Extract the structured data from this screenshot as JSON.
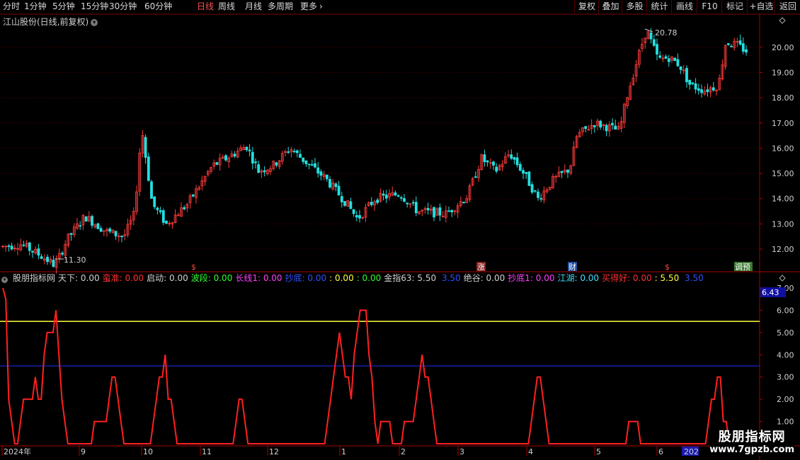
{
  "toolbar": {
    "periods": [
      "分时",
      "1分钟",
      "5分钟",
      "15分钟",
      "30分钟",
      "60分钟",
      "日线",
      "周线",
      "月线",
      "多周期",
      "更多"
    ],
    "active_period": "日线",
    "more_arrow": "›",
    "right_buttons": [
      "复权",
      "叠加",
      "多股",
      "统计",
      "画线",
      "F10",
      "标记",
      "+自选",
      "返回"
    ]
  },
  "main_chart": {
    "title": "江山股份(日线,前复权)",
    "high_label": "20.78",
    "low_label": "11.30",
    "y_ticks": [
      "20.00",
      "19.00",
      "18.00",
      "17.00",
      "16.00",
      "15.00",
      "14.00",
      "13.00",
      "12.00"
    ],
    "event_markers": [
      "$",
      "涨",
      "财",
      "$",
      "调预"
    ],
    "colors": {
      "up": "#ff3b3b",
      "down": "#22e0e0",
      "grid": "#5a0000",
      "axis": "#aa0000"
    }
  },
  "indicator": {
    "name": "股朋指标网",
    "items": [
      {
        "label": "天下:",
        "value": "0.00",
        "color": "#d0d0d0"
      },
      {
        "label": "蛮准:",
        "value": "0.00",
        "color": "#ff3030"
      },
      {
        "label": "启动:",
        "value": "0.00",
        "color": "#d0d0d0"
      },
      {
        "label": "波段:",
        "value": "0.00",
        "color": "#30ff30"
      },
      {
        "label": "长线1:",
        "value": "0.00",
        "color": "#ff40ff"
      },
      {
        "label": "抄底:",
        "value": "0.00",
        "color": "#3050ff"
      },
      {
        "label": ":",
        "value": "0.00",
        "color": "#ffff40"
      },
      {
        "label": ":",
        "value": "0.00",
        "color": "#30ff30"
      },
      {
        "label": "金指63:",
        "value": "5.50",
        "color": "#d0d0d0"
      },
      {
        "label": "",
        "value": "3.50",
        "color": "#3050ff"
      },
      {
        "label": "绝谷:",
        "value": "0.00",
        "color": "#d0d0d0"
      },
      {
        "label": "抄底1:",
        "value": "0.00",
        "color": "#ff40ff"
      },
      {
        "label": "江湖:",
        "value": "0.00",
        "color": "#40e0ff"
      },
      {
        "label": "买得好:",
        "value": "0.00",
        "color": "#ff3030"
      },
      {
        "label": ":",
        "value": "5.50",
        "color": "#ffff40"
      },
      {
        "label": "",
        "value": "3.50",
        "color": "#3050ff"
      }
    ],
    "y_ticks": [
      "7.00",
      "6.00",
      "5.00",
      "4.00",
      "3.00",
      "2.00",
      "1.00"
    ],
    "current_value": "6.43",
    "yellow_level": 5.5,
    "blue_level": 3.5,
    "line_color": "#ff2020",
    "line_values": [
      7,
      6.5,
      2,
      1,
      0,
      0,
      1,
      2,
      2,
      2,
      2,
      3,
      2,
      2,
      4,
      5,
      5,
      5,
      6,
      4,
      2,
      1,
      0,
      0,
      0,
      0,
      0,
      0,
      0,
      0,
      0,
      1,
      1,
      1,
      1,
      1,
      2,
      3,
      3,
      2,
      1,
      0,
      0,
      0,
      0,
      0,
      0,
      0,
      0,
      0,
      0,
      1,
      2,
      3,
      3,
      4,
      2,
      2,
      1,
      0,
      0,
      0,
      0,
      0,
      0,
      0,
      0,
      0,
      0,
      0,
      0,
      0,
      0,
      0,
      0,
      0,
      0,
      0,
      0,
      1,
      2,
      2,
      1,
      0,
      0,
      0,
      0,
      0,
      0,
      0,
      0,
      0,
      0,
      0,
      0,
      0,
      0,
      0,
      0,
      0,
      0,
      0,
      0,
      0,
      0,
      0,
      0,
      0,
      0,
      0,
      1,
      2,
      3,
      4,
      5,
      4,
      3,
      3,
      2,
      4,
      5,
      6,
      6,
      6,
      4,
      3,
      1,
      0,
      1,
      1,
      1,
      1,
      0,
      0,
      0,
      0,
      1,
      1,
      1,
      1,
      2,
      3,
      4,
      3,
      3,
      2,
      1,
      0,
      0,
      0,
      0,
      0,
      0,
      0,
      0,
      0,
      0,
      0,
      0,
      0,
      0,
      0,
      0,
      0,
      0,
      0,
      0,
      0,
      0,
      0,
      0,
      0,
      0,
      0,
      0,
      0,
      0,
      0,
      0,
      1,
      2,
      3,
      3,
      2,
      1,
      0,
      0,
      0,
      0,
      0,
      0,
      0,
      0,
      0,
      0,
      0,
      0,
      0,
      0,
      0,
      0,
      0,
      0,
      0,
      0,
      0,
      0,
      0,
      0,
      0,
      0,
      0,
      1,
      1,
      1,
      1,
      0,
      0,
      0,
      0,
      0,
      0,
      0,
      0,
      0,
      0,
      0,
      0,
      0,
      0,
      0,
      0,
      0,
      0,
      0,
      0,
      0,
      0,
      0,
      1,
      2,
      2,
      3,
      3,
      1,
      1,
      0
    ]
  },
  "time_axis": {
    "labels": [
      "2024年",
      "9",
      "10",
      "11",
      "12",
      "1",
      "2",
      "3",
      "4",
      "5",
      "6",
      "202"
    ]
  },
  "watermark": {
    "line1": "股朋指标网",
    "line2": "www.7gpzb.com"
  }
}
